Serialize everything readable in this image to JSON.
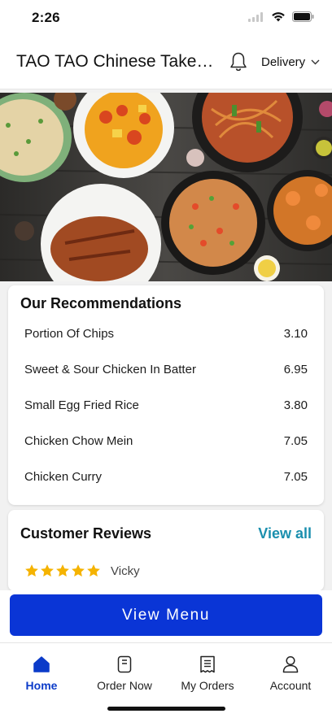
{
  "status_bar": {
    "time": "2:26"
  },
  "header": {
    "title": "TAO TAO Chinese Takeaway",
    "order_mode": "Delivery"
  },
  "recommendations": {
    "title": "Our Recommendations",
    "items": [
      {
        "name": "Portion Of Chips",
        "price": "3.10"
      },
      {
        "name": "Sweet & Sour Chicken In Batter",
        "price": "6.95"
      },
      {
        "name": "Small Egg Fried Rice",
        "price": "3.80"
      },
      {
        "name": "Chicken Chow Mein",
        "price": "7.05"
      },
      {
        "name": "Chicken Curry",
        "price": "7.05"
      }
    ]
  },
  "reviews": {
    "title": "Customer Reviews",
    "view_all": "View all",
    "first_review": {
      "rating": 5,
      "max_rating": 5,
      "author": "Vicky"
    }
  },
  "cta": {
    "label": "View Menu"
  },
  "tab_bar": {
    "items": [
      {
        "label": "Home",
        "icon": "home-icon",
        "active": true
      },
      {
        "label": "Order Now",
        "icon": "order-now-icon",
        "active": false
      },
      {
        "label": "My Orders",
        "icon": "my-orders-icon",
        "active": false
      },
      {
        "label": "Account",
        "icon": "account-icon",
        "active": false
      }
    ]
  },
  "colors": {
    "accent": "#0a35d6",
    "link": "#1a8fae",
    "star": "#f5b301",
    "active_tab": "#0b3bc9"
  }
}
